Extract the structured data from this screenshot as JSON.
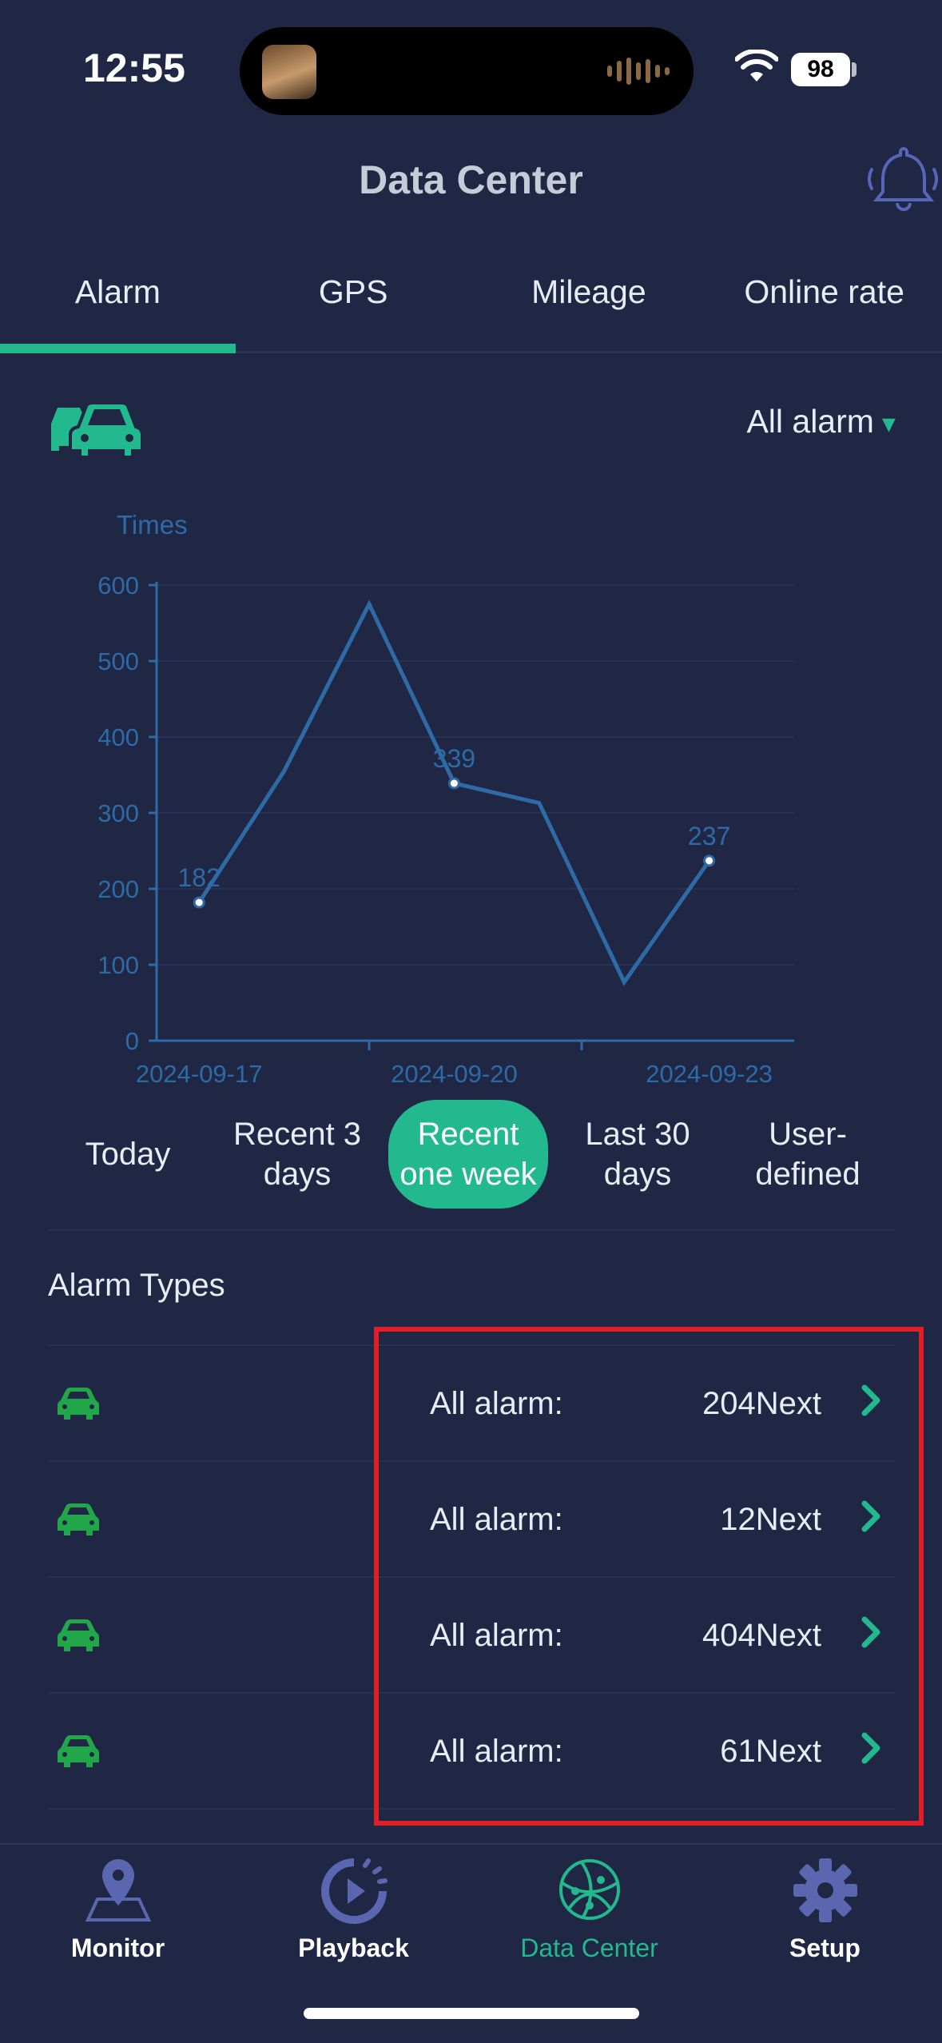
{
  "status_bar": {
    "time": "12:55",
    "battery": "98"
  },
  "header": {
    "title": "Data Center"
  },
  "tabs": [
    {
      "label": "Alarm",
      "active": true
    },
    {
      "label": "GPS",
      "active": false
    },
    {
      "label": "Mileage",
      "active": false
    },
    {
      "label": "Online rate",
      "active": false
    }
  ],
  "filter": {
    "label": "All alarm",
    "caret": "▾"
  },
  "chart_data": {
    "type": "line",
    "ylabel": "Times",
    "ylim": [
      0,
      600
    ],
    "yticks": [
      0,
      100,
      200,
      300,
      400,
      500,
      600
    ],
    "x": [
      "2024-09-17",
      "2024-09-18",
      "2024-09-19",
      "2024-09-20",
      "2024-09-21",
      "2024-09-22",
      "2024-09-23"
    ],
    "xtick_labels": [
      "2024-09-17",
      "2024-09-20",
      "2024-09-23"
    ],
    "values": [
      182,
      355,
      575,
      339,
      313,
      77,
      237
    ],
    "data_labels": [
      {
        "index": 0,
        "text": "182"
      },
      {
        "index": 3,
        "text": "339"
      },
      {
        "index": 6,
        "text": "237"
      }
    ],
    "color": "#2e6aa6",
    "grid": true
  },
  "periods": [
    {
      "label": "Today",
      "active": false
    },
    {
      "label": "Recent 3 days",
      "active": false
    },
    {
      "label": "Recent one week",
      "active": true
    },
    {
      "label": "Last 30 days",
      "active": false
    },
    {
      "label": "User-defined",
      "active": false
    }
  ],
  "alarm_types": {
    "title": "Alarm Types",
    "rows": [
      {
        "label": "All alarm:",
        "count": "204Next"
      },
      {
        "label": "All alarm:",
        "count": "12Next"
      },
      {
        "label": "All alarm:",
        "count": "404Next"
      },
      {
        "label": "All alarm:",
        "count": "61Next"
      }
    ]
  },
  "bottom_nav": [
    {
      "label": "Monitor",
      "icon": "map-pin-icon",
      "active": false
    },
    {
      "label": "Playback",
      "icon": "playback-icon",
      "active": false
    },
    {
      "label": "Data Center",
      "icon": "globe-icon",
      "active": true
    },
    {
      "label": "Setup",
      "icon": "gear-icon",
      "active": false
    }
  ],
  "colors": {
    "background": "#1f2744",
    "accent": "#22b98e",
    "highlight": "#e11d26",
    "car_icon": "#22a64a"
  }
}
